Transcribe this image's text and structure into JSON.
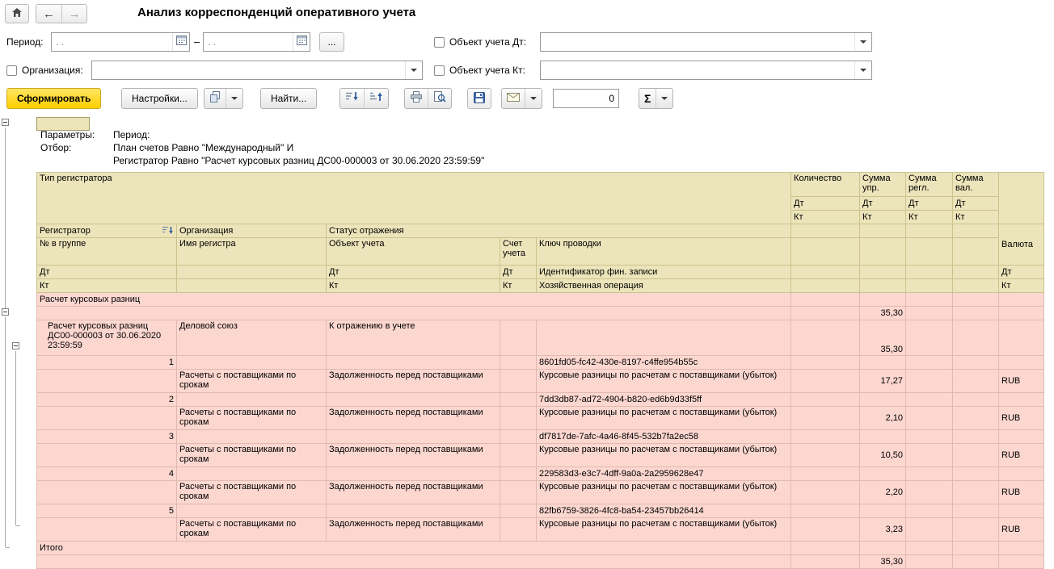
{
  "window": {
    "title": "Анализ корреспонденций оперативного учета"
  },
  "filters": {
    "period_label": "Период:",
    "period_placeholder": ". .",
    "range_dash": "–",
    "more_label": "...",
    "organization_label": "Организация:",
    "object_dt_label": "Объект учета Дт:",
    "object_kt_label": "Объект учета Кт:"
  },
  "toolbar": {
    "generate_label": "Сформировать",
    "settings_label": "Настройки...",
    "find_label": "Найти...",
    "counter_value": "0",
    "sigma_label": "Σ"
  },
  "report_header": {
    "params_label": "Параметры:",
    "params_value": "Период:",
    "filter_label": "Отбор:",
    "filter_line1": "План счетов Равно \"Международный\" И",
    "filter_line2": "Регистратор Равно \"Расчет курсовых разниц ДС00-000003 от 30.06.2020 23:59:59\""
  },
  "table": {
    "header": {
      "registrar_type": "Тип регистратора",
      "quantity": "Количество",
      "sum_mgmt": "Сумма упр.",
      "sum_regl": "Сумма регл.",
      "sum_val": "Сумма вал.",
      "dt": "Дт",
      "kt": "Кт",
      "registrar": "Регистратор",
      "organization": "Организация",
      "reflection_status": "Статус отражения",
      "group_num": "№ в группе",
      "register_name": "Имя регистра",
      "accounting_object": "Объект учета",
      "account": "Счет учета",
      "posting_key": "Ключ проводки",
      "currency": "Валюта",
      "fin_record_id": "Идентификатор фин. записи",
      "business_operation": "Хозяйственная операция"
    },
    "group": {
      "name": "Расчет курсовых разниц",
      "total": "35,30"
    },
    "registrar_group": {
      "name": "Расчет курсовых разниц ДС00-000003 от 30.06.2020 23:59:59",
      "organization": "Деловой союз",
      "status": "К отражению в учете",
      "total": "35,30"
    },
    "records": [
      {
        "num": "1",
        "posting_key": "8601fd05-fc42-430e-8197-c4ffe954b55c",
        "register_name": "Расчеты с поставщиками по срокам",
        "object": "Задолженность перед поставщиками",
        "operation": "Курсовые разницы по расчетам с поставщиками (убыток)",
        "amount": "17,27",
        "currency": "RUB"
      },
      {
        "num": "2",
        "posting_key": "7dd3db87-ad72-4904-b820-ed6b9d33f5ff",
        "register_name": "Расчеты с поставщиками по срокам",
        "object": "Задолженность перед поставщиками",
        "operation": "Курсовые разницы по расчетам с поставщиками (убыток)",
        "amount": "2,10",
        "currency": "RUB"
      },
      {
        "num": "3",
        "posting_key": "df7817de-7afc-4a46-8f45-532b7fa2ec58",
        "register_name": "Расчеты с поставщиками по срокам",
        "object": "Задолженность перед поставщиками",
        "operation": "Курсовые разницы по расчетам с поставщиками (убыток)",
        "amount": "10,50",
        "currency": "RUB"
      },
      {
        "num": "4",
        "posting_key": "229583d3-e3c7-4dff-9a0a-2a2959628e47",
        "register_name": "Расчеты с поставщиками по срокам",
        "object": "Задолженность перед поставщиками",
        "operation": "Курсовые разницы по расчетам с поставщиками (убыток)",
        "amount": "2,20",
        "currency": "RUB"
      },
      {
        "num": "5",
        "posting_key": "82fb6759-3826-4fc8-ba54-23457bb26414",
        "register_name": "Расчеты с поставщиками по срокам",
        "object": "Задолженность перед поставщиками",
        "operation": "Курсовые разницы по расчетам с поставщиками (убыток)",
        "amount": "3,23",
        "currency": "RUB"
      }
    ],
    "total_label": "Итого",
    "grand_total": "35,30"
  },
  "colors": {
    "accent_yellow": "#FFD215",
    "header_cell": "#ECE4BA",
    "data_cell": "#FCD7D0"
  }
}
